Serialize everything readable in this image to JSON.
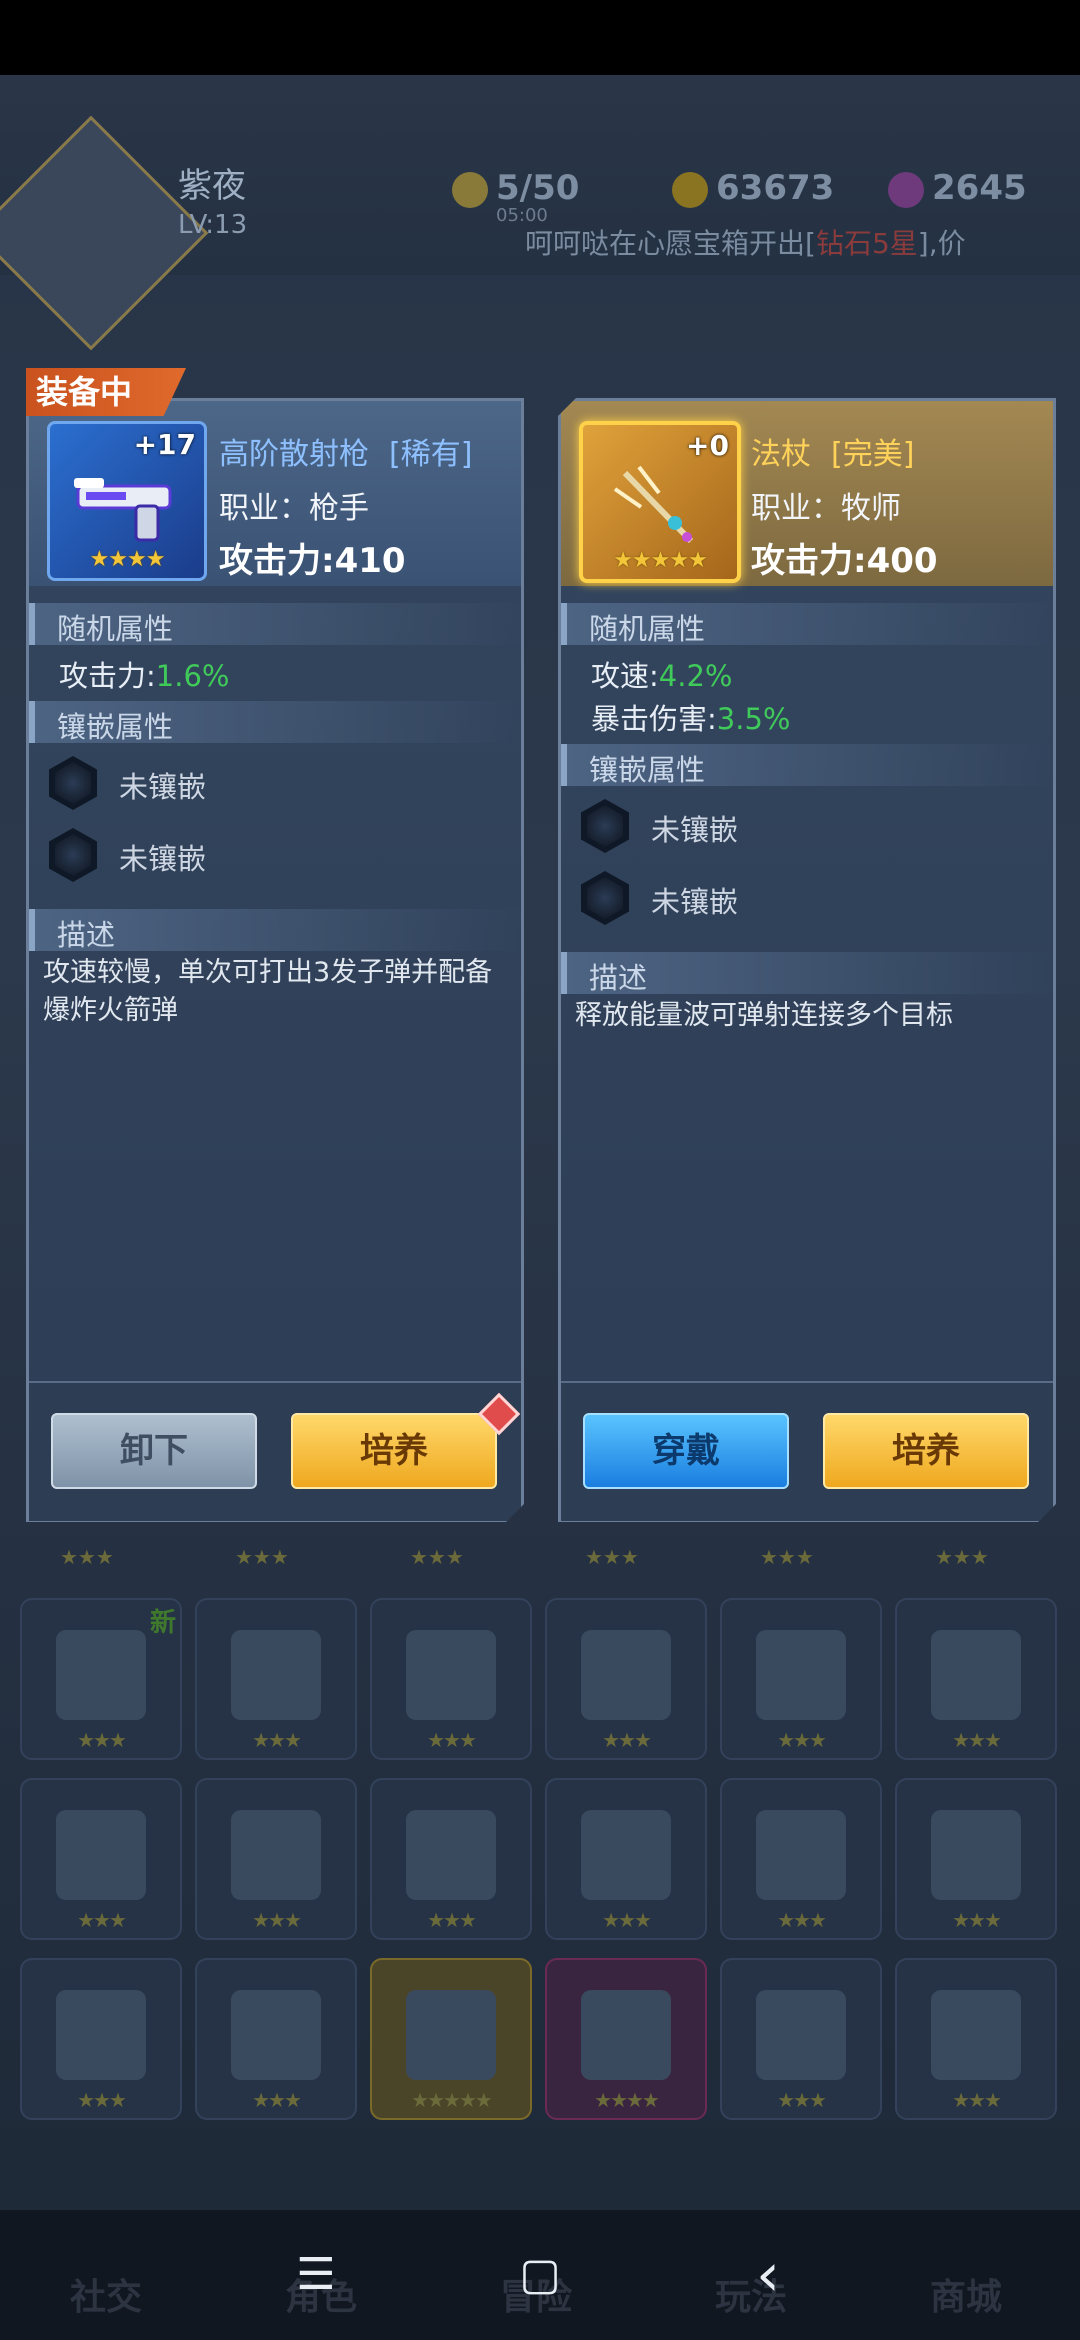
{
  "player": {
    "name": "紫夜",
    "level": "LV:13",
    "energy": "5/50",
    "energy_timer": "05:00",
    "gold": "63673",
    "gems": "2645",
    "ticker_prefix": "呵呵哒在心愿宝箱开出[",
    "ticker_highlight": "钻石5星",
    "ticker_suffix": "],价"
  },
  "equipped_tag": "装备中",
  "left_card": {
    "plus": "+17",
    "stars": "★★★★",
    "name": "高阶散射枪",
    "rarity": "[稀有]",
    "class": "职业：枪手",
    "attack": "攻击力:410",
    "random_section": "随机属性",
    "random_attrs": [
      {
        "label": "攻击力:",
        "value": "1.6%"
      }
    ],
    "gem_section": "镶嵌属性",
    "gems": [
      "未镶嵌",
      "未镶嵌"
    ],
    "desc_section": "描述",
    "description": "攻速较慢，单次可打出3发子弹并配备爆炸火箭弹",
    "buttons": {
      "unequip": "卸下",
      "train": "培养"
    }
  },
  "right_card": {
    "plus": "+0",
    "stars": "★★★★★",
    "name": "法杖",
    "rarity": "[完美]",
    "class": "职业：牧师",
    "attack": "攻击力:400",
    "random_section": "随机属性",
    "random_attrs": [
      {
        "label": "攻速:",
        "value": "4.2%"
      },
      {
        "label": "暴击伤害:",
        "value": "3.5%"
      }
    ],
    "gem_section": "镶嵌属性",
    "gems": [
      "未镶嵌",
      "未镶嵌"
    ],
    "desc_section": "描述",
    "description": "释放能量波可弹射连接多个目标",
    "buttons": {
      "wear": "穿戴",
      "train": "培养"
    }
  },
  "inventory": {
    "new_label": "新",
    "star3": "★★★",
    "star4": "★★★★",
    "star5": "★★★★★"
  },
  "nav": {
    "social": "社交",
    "role": "角色",
    "adventure": "冒险",
    "play": "玩法",
    "shop": "商城"
  },
  "system_nav": {
    "menu": "☰",
    "home": "▢",
    "back": "‹"
  },
  "colors": {
    "accent_gold": "#f3c63a",
    "attr_green": "#3fca5a",
    "rare_blue": "#8ec0ff",
    "perfect_gold": "#ffd25a"
  }
}
